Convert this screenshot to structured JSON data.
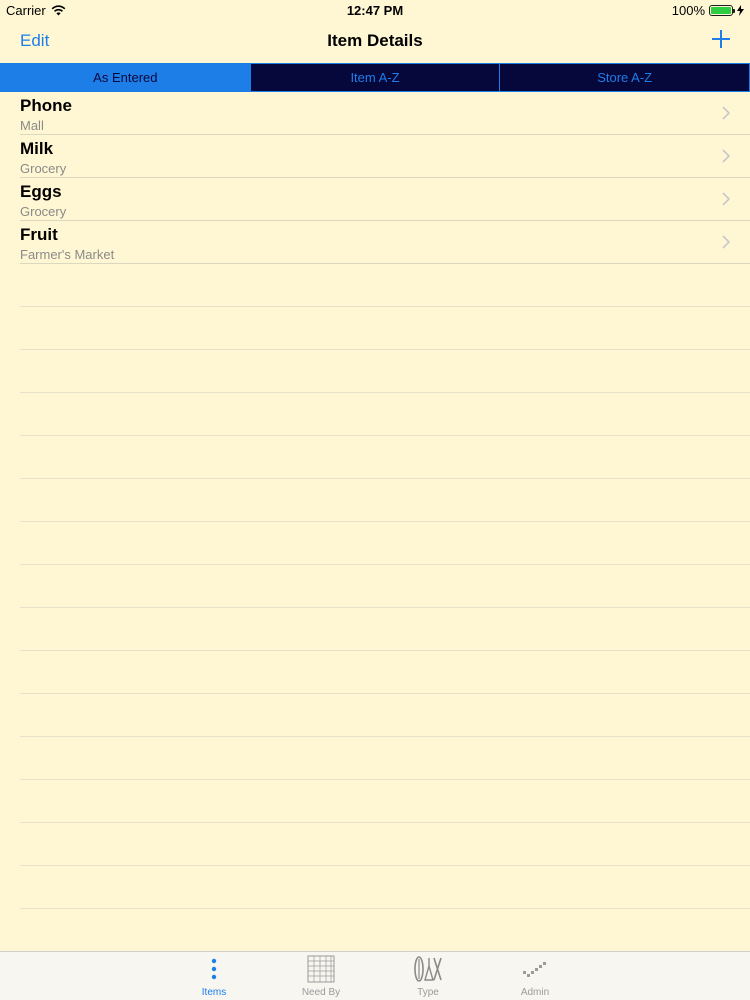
{
  "status_bar": {
    "carrier": "Carrier",
    "time": "12:47 PM",
    "battery": "100%"
  },
  "nav": {
    "edit_label": "Edit",
    "title": "Item Details",
    "add_icon": "plus-icon"
  },
  "segments": [
    {
      "label": "As Entered",
      "selected": true
    },
    {
      "label": "Item A-Z",
      "selected": false
    },
    {
      "label": "Store A-Z",
      "selected": false
    }
  ],
  "items": [
    {
      "name": "Phone",
      "store": "Mall"
    },
    {
      "name": "Milk",
      "store": "Grocery"
    },
    {
      "name": "Eggs",
      "store": "Grocery"
    },
    {
      "name": "Fruit",
      "store": "Farmer's Market"
    }
  ],
  "tabs": [
    {
      "label": "Items",
      "icon": "dots-vertical-icon",
      "active": true
    },
    {
      "label": "Need By",
      "icon": "calendar-grid-icon",
      "active": false
    },
    {
      "label": "Type",
      "icon": "utensils-icon",
      "active": false
    },
    {
      "label": "Admin",
      "icon": "checkmark-icon",
      "active": false
    }
  ],
  "colors": {
    "background": "#fff7d3",
    "accent": "#1e7ee8",
    "segment_dark": "#06073a"
  }
}
